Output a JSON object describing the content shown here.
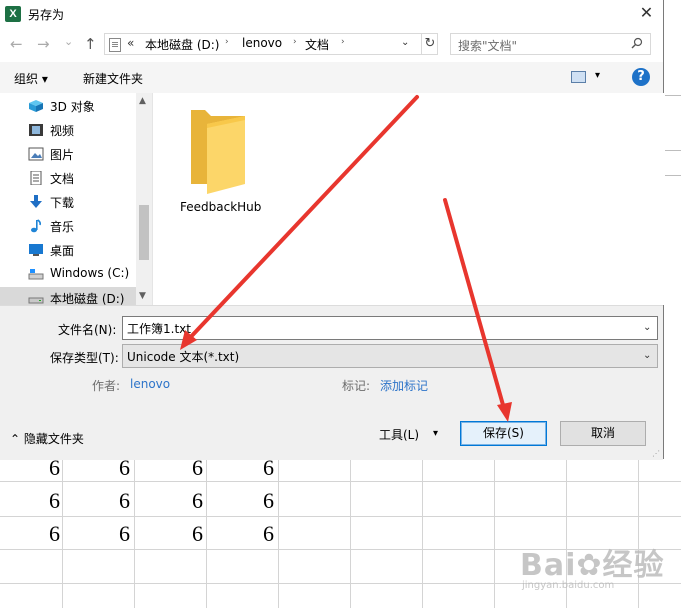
{
  "window": {
    "title": "另存为",
    "app_icon": "X",
    "close_glyph": "✕"
  },
  "nav": {
    "back_glyph": "←",
    "forward_glyph": "→",
    "history_glyph": "⌄",
    "up_glyph": "↑",
    "address_prefix": "«",
    "breadcrumbs": [
      "本地磁盘 (D:)",
      "lenovo",
      "文档"
    ],
    "refresh_glyph": "↻",
    "search_placeholder": "搜索\"文档\""
  },
  "toolbar": {
    "organize": "组织 ▾",
    "new_folder": "新建文件夹",
    "help": "?"
  },
  "sidebar": {
    "items": [
      {
        "label": "3D 对象",
        "icon": "cube-icon"
      },
      {
        "label": "视频",
        "icon": "video-icon"
      },
      {
        "label": "图片",
        "icon": "picture-icon"
      },
      {
        "label": "文档",
        "icon": "document-icon"
      },
      {
        "label": "下载",
        "icon": "download-icon"
      },
      {
        "label": "音乐",
        "icon": "music-icon"
      },
      {
        "label": "桌面",
        "icon": "desktop-icon"
      },
      {
        "label": "Windows (C:)",
        "icon": "drive-icon"
      },
      {
        "label": "本地磁盘 (D:)",
        "icon": "drive-icon"
      }
    ]
  },
  "files": [
    {
      "name": "FeedbackHub",
      "icon": "folder-icon"
    }
  ],
  "form": {
    "filename_label": "文件名(N):",
    "filename_value": "工作簿1.txt",
    "type_label": "保存类型(T):",
    "type_value": "Unicode 文本(*.txt)",
    "author_label": "作者:",
    "author_value": "lenovo",
    "tags_label": "标记:",
    "tags_value": "添加标记"
  },
  "footer": {
    "hide_folders": "隐藏文件夹",
    "tools": "工具(L)",
    "save": "保存(S)",
    "cancel": "取消"
  },
  "sheet": {
    "rows": [
      [
        "6",
        "6",
        "6",
        "6"
      ],
      [
        "6",
        "6",
        "6",
        "6"
      ],
      [
        "6",
        "6",
        "6",
        "6"
      ]
    ]
  },
  "colors": {
    "accent": "#0078d7",
    "arrow": "#e8362e",
    "link": "#2d74c9"
  }
}
